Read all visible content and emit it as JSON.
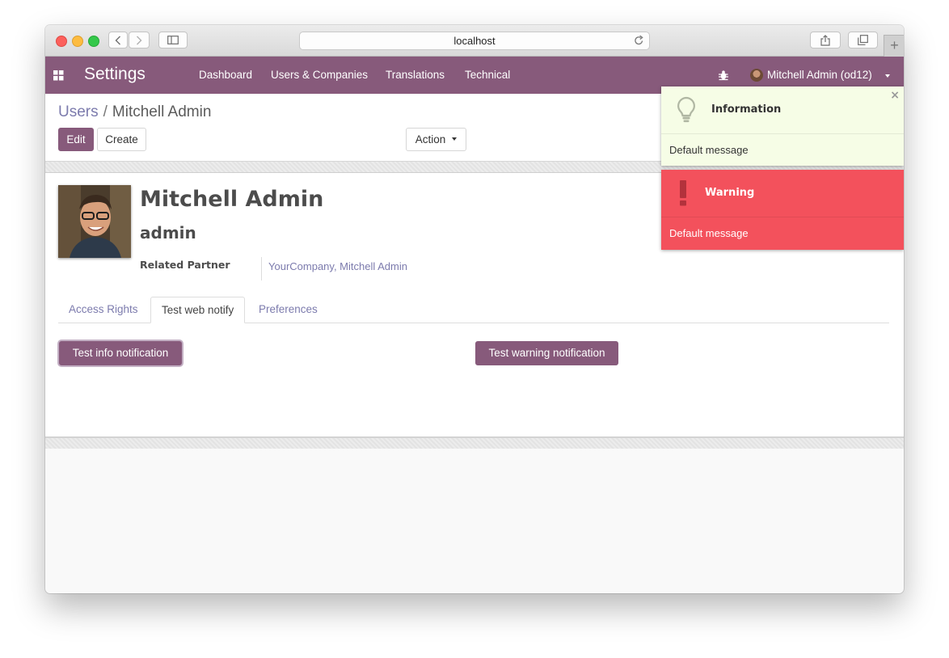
{
  "browser": {
    "url": "localhost",
    "new_tab_label": "+"
  },
  "navbar": {
    "app_title": "Settings",
    "menu": [
      "Dashboard",
      "Users & Companies",
      "Translations",
      "Technical"
    ],
    "user_name": "Mitchell Admin (od12)"
  },
  "control_panel": {
    "breadcrumb_parent": "Users",
    "breadcrumb_separator": "/",
    "breadcrumb_current": "Mitchell Admin",
    "edit_label": "Edit",
    "create_label": "Create",
    "action_label": "Action"
  },
  "form": {
    "name": "Mitchell Admin",
    "login": "admin",
    "related_partner_label": "Related Partner",
    "related_partner_value": "YourCompany, Mitchell Admin",
    "tabs": [
      "Access Rights",
      "Test web notify",
      "Preferences"
    ],
    "active_tab": "Test web notify",
    "info_button": "Test info notification",
    "warning_button": "Test warning notification"
  },
  "notifications": [
    {
      "type": "info",
      "title": "Information",
      "message": "Default message",
      "close": "×",
      "color": "#f6fde6"
    },
    {
      "type": "warning",
      "title": "Warning",
      "message": "Default message",
      "color": "#f3515c"
    }
  ],
  "colors": {
    "brand": "#875a7b",
    "link": "#7c7bad"
  }
}
